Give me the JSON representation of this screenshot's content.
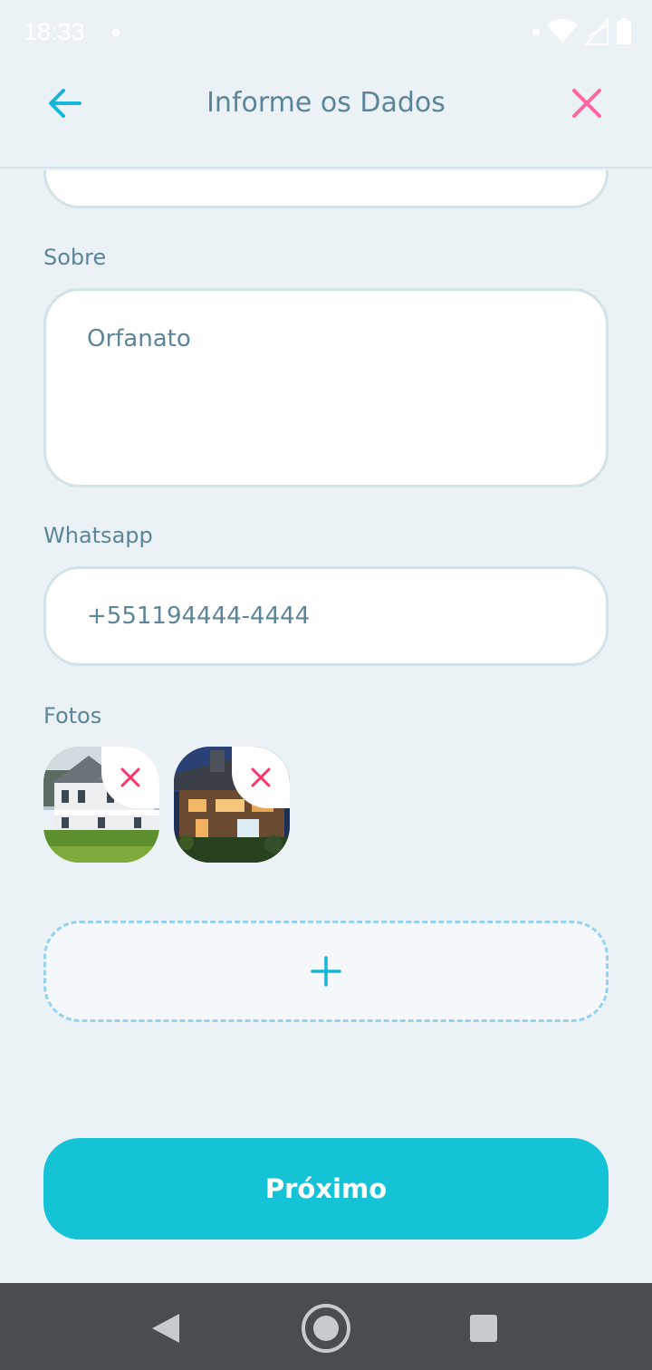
{
  "status_bar": {
    "time": "18:33"
  },
  "header": {
    "title": "Informe os Dados",
    "back_icon": "arrow-left-icon",
    "close_icon": "close-icon"
  },
  "form": {
    "about_label": "Sobre",
    "about_value": "Orfanato",
    "whatsapp_label": "Whatsapp",
    "whatsapp_value": "+551194444-4444",
    "photos_label": "Fotos",
    "photos_count": 2,
    "add_photo_icon": "plus-icon",
    "next_label": "Próximo"
  },
  "colors": {
    "background": "#EBF2F5",
    "accent": "#15C3D6",
    "text": "#5C8599",
    "close": "#FF669D",
    "border": "#D3E2E6",
    "dashed_border": "#96D2F0"
  }
}
